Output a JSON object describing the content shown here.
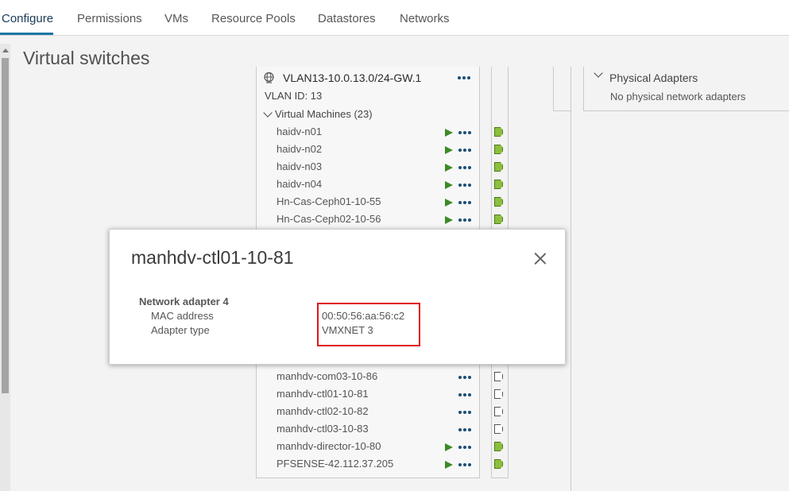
{
  "tabs": [
    {
      "label": "Configure"
    },
    {
      "label": "Permissions"
    },
    {
      "label": "VMs"
    },
    {
      "label": "Resource Pools"
    },
    {
      "label": "Datastores"
    },
    {
      "label": "Networks"
    }
  ],
  "page": {
    "title": "Virtual switches"
  },
  "portgroup": {
    "name": "VLAN13-10.0.13.0/24-GW.1",
    "vlan": "VLAN ID: 13",
    "vm_header": "Virtual Machines (23)",
    "vms": [
      {
        "name": "haidv-n01",
        "powered_on": true
      },
      {
        "name": "haidv-n02",
        "powered_on": true
      },
      {
        "name": "haidv-n03",
        "powered_on": true
      },
      {
        "name": "haidv-n04",
        "powered_on": true
      },
      {
        "name": "Hn-Cas-Ceph01-10-55",
        "powered_on": true
      },
      {
        "name": "Hn-Cas-Ceph02-10-56",
        "powered_on": true
      }
    ],
    "vms_bottom": [
      {
        "name": "manhdv-com03-10-86",
        "powered_on": false
      },
      {
        "name": "manhdv-ctl01-10-81",
        "powered_on": false
      },
      {
        "name": "manhdv-ctl02-10-82",
        "powered_on": false
      },
      {
        "name": "manhdv-ctl03-10-83",
        "powered_on": false
      },
      {
        "name": "manhdv-director-10-80",
        "powered_on": true
      },
      {
        "name": "PFSENSE-42.112.37.205",
        "powered_on": true
      }
    ]
  },
  "physical_adapters": {
    "title": "Physical Adapters",
    "empty_text": "No physical network adapters"
  },
  "modal": {
    "title": "manhdv-ctl01-10-81",
    "section": "Network adapter 4",
    "mac_label": "MAC address",
    "mac_value": "00:50:56:aa:56:c2",
    "type_label": "Adapter type",
    "type_value": "VMXNET 3"
  },
  "colors": {
    "accent": "#1a76a6",
    "powered_on": "#3c8a26",
    "highlight": "#e0131b"
  }
}
